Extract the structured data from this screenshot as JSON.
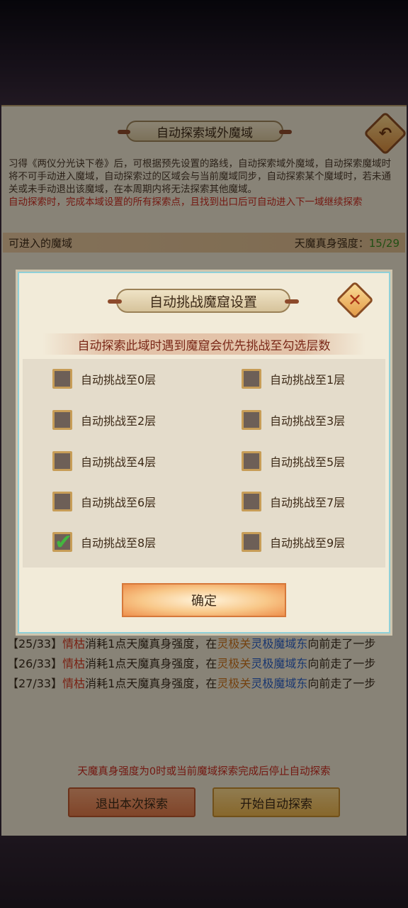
{
  "header": {
    "title": "自动探索域外魔域",
    "back_icon": "back-arrow-icon"
  },
  "description": {
    "normal": "习得《两仪分光诀下卷》后，可根据预先设置的路线，自动探索域外魔域，自动探索魔域时将不可手动进入魔域，自动探索过的区域会与当前魔域同步，自动探索某个魔域时，若未通关或未手动退出该魔域，在本周期内将无法探索其他魔域。",
    "warning": "自动探索时，完成本域设置的所有探索点，且找到出口后可自动进入下一域继续探索"
  },
  "status_bar": {
    "left": "可进入的魔域",
    "right_label": "天魔真身强度：",
    "right_value": "15/29"
  },
  "log": [
    {
      "prefix": "【25/33】",
      "who": "情枯",
      "mid": "消耗1点天魔真身强度，在",
      "place1": "灵极关",
      "place2": "灵极魔域东",
      "suffix": "向前走了一步"
    },
    {
      "prefix": "【26/33】",
      "who": "情枯",
      "mid": "消耗1点天魔真身强度，在",
      "place1": "灵极关",
      "place2": "灵极魔域东",
      "suffix": "向前走了一步"
    },
    {
      "prefix": "【27/33】",
      "who": "情枯",
      "mid": "消耗1点天魔真身强度，在",
      "place1": "灵极关",
      "place2": "灵极魔域东",
      "suffix": "向前走了一步"
    }
  ],
  "bottom_note": "天魔真身强度为0时或当前魔域探索完成后停止自动探索",
  "buttons": {
    "exit": "退出本次探索",
    "start": "开始自动探索"
  },
  "modal": {
    "title": "自动挑战魔窟设置",
    "close_icon": "close-x-icon",
    "subtitle": "自动探索此域时遇到魔窟会优先挑战至勾选层数",
    "options": [
      {
        "label": "自动挑战至0层",
        "checked": false
      },
      {
        "label": "自动挑战至1层",
        "checked": false
      },
      {
        "label": "自动挑战至2层",
        "checked": false
      },
      {
        "label": "自动挑战至3层",
        "checked": false
      },
      {
        "label": "自动挑战至4层",
        "checked": false
      },
      {
        "label": "自动挑战至5层",
        "checked": false
      },
      {
        "label": "自动挑战至6层",
        "checked": false
      },
      {
        "label": "自动挑战至7层",
        "checked": false
      },
      {
        "label": "自动挑战至8层",
        "checked": true
      },
      {
        "label": "自动挑战至9层",
        "checked": false
      }
    ],
    "confirm": "确定"
  }
}
